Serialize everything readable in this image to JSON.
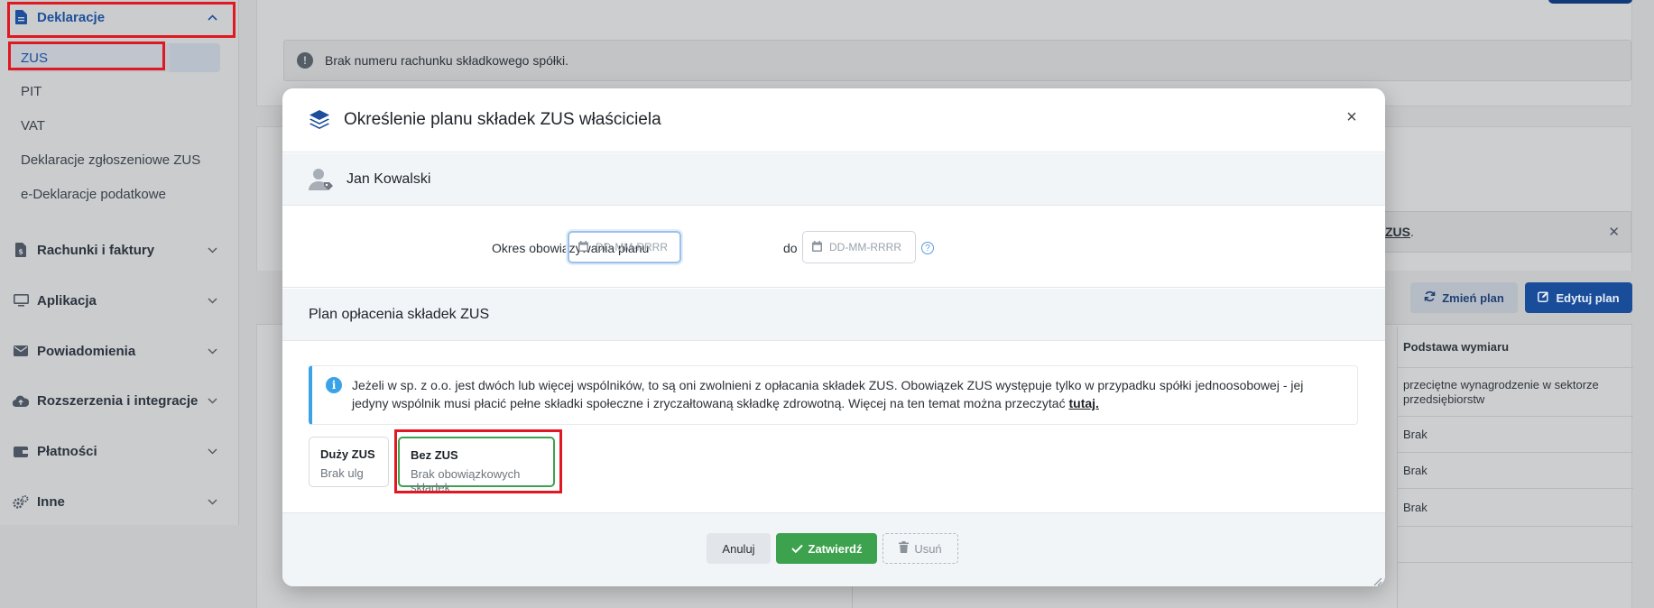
{
  "sidebar": {
    "section_deklaracje": "Deklaracje",
    "items": [
      "ZUS",
      "PIT",
      "VAT",
      "Deklaracje zgłoszeniowe ZUS",
      "e-Deklaracje podatkowe"
    ],
    "sections": [
      "Rachunki i faktury",
      "Aplikacja",
      "Powiadomienia",
      "Rozszerzenia i integracje",
      "Płatności",
      "Inne"
    ]
  },
  "background": {
    "alert_text": "Brak numeru rachunku składkowego spółki.",
    "info_link": "ZUS",
    "info_suffix": ".",
    "btn_zmien": "Zmień plan",
    "btn_edytuj": "Edytuj plan",
    "col_header": "Podstawa wymiaru",
    "cells": [
      "przeciętne wynagrodzenie w sektorze przedsiębiorstw",
      "Brak",
      "Brak",
      "Brak"
    ]
  },
  "modal": {
    "title": "Określenie planu składek ZUS właściciela",
    "person": "Jan Kowalski",
    "period_label": "Okres obowiązywania planu",
    "date_from_placeholder": "DD-MM-RRRR",
    "date_to_placeholder": "DD-MM-RRRR",
    "do_label": "do",
    "plan_heading": "Plan opłacenia składek ZUS",
    "info_text": "Jeżeli w sp. z o.o. jest dwóch lub więcej wspólników, to są oni zwolnieni z opłacania składek ZUS. Obowiązek ZUS występuje tylko w przypadku spółki jednoosobowej - jej jedyny wspólnik musi płacić pełne składki społeczne i zryczałtowaną składkę zdrowotną. Więcej na ten temat można przeczytać",
    "info_link": "tutaj.",
    "options": [
      {
        "title": "Duży ZUS",
        "sub": "Brak ulg",
        "selected": false
      },
      {
        "title": "Bez ZUS",
        "sub": "Brak obowiązkowych składek",
        "selected": true
      }
    ],
    "btn_anuluj": "Anuluj",
    "btn_zatwierdz": "Zatwierdź",
    "btn_usun": "Usuń"
  },
  "colors": {
    "accent_blue": "#1d4f9c",
    "success_green": "#3ca24d",
    "info_blue": "#3aa3e8",
    "highlight_red": "#e01822"
  }
}
